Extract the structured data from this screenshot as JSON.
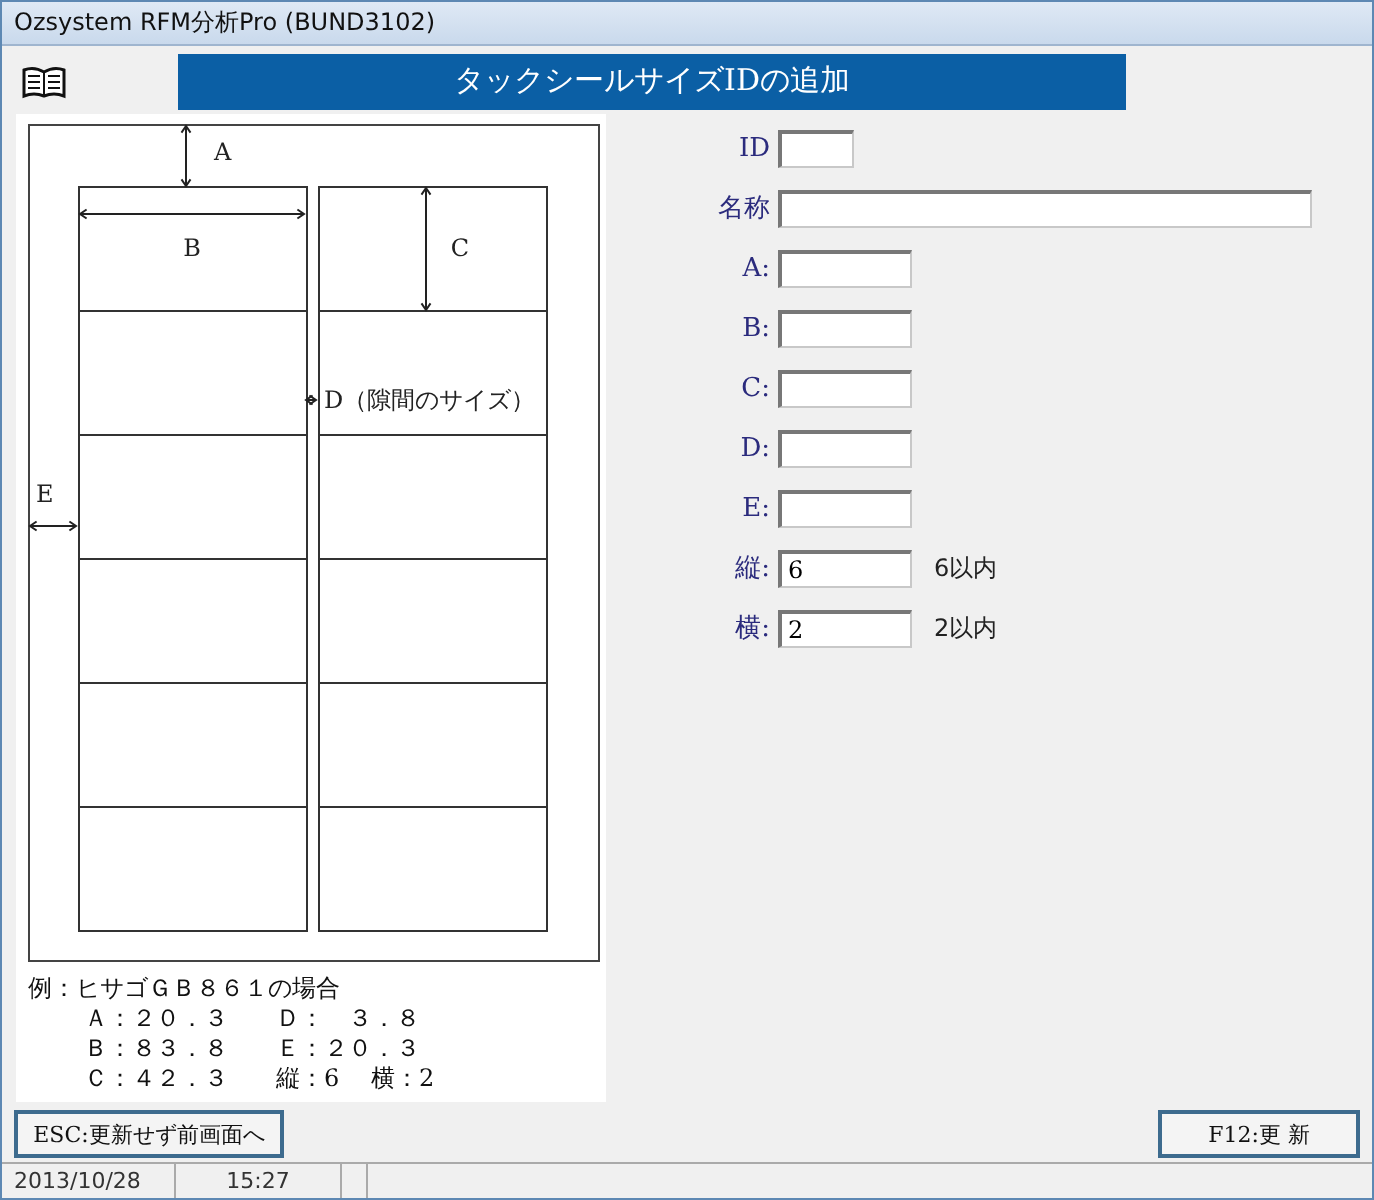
{
  "window": {
    "title": "Ozsystem RFM分析Pro (BUND3102)"
  },
  "header": {
    "title": "タックシールサイズIDの追加"
  },
  "diagram": {
    "labels": [
      {
        "kind": "a",
        "text": "A"
      },
      {
        "kind": "b",
        "text": "B"
      },
      {
        "kind": "c",
        "text": "C"
      },
      {
        "kind": "d",
        "text": "D（隙間のサイズ）"
      },
      {
        "kind": "e",
        "text": "E"
      }
    ]
  },
  "example": {
    "heading": "例：ヒサゴＧＢ８６１の場合",
    "lines": [
      "Ａ：２０．３　　Ｄ：　３．８",
      "Ｂ：８３．８　　Ｅ：２０．３",
      "Ｃ：４２．３　　縦：6　 横：2"
    ]
  },
  "fields": [
    {
      "label": "ID",
      "kind": "tiny"
    },
    {
      "label": "名称",
      "kind": "long"
    },
    {
      "label": "A:",
      "kind": "short"
    },
    {
      "label": "B:",
      "kind": "short"
    },
    {
      "label": "C:",
      "kind": "short"
    },
    {
      "label": "D:",
      "kind": "short"
    },
    {
      "label": "E:",
      "kind": "short"
    },
    {
      "label": "縦:",
      "kind": "short",
      "value": "6",
      "note": "6以内"
    },
    {
      "label": "横:",
      "kind": "short",
      "value": "2",
      "note": "2以内"
    }
  ],
  "buttons": [
    {
      "label": "ESC:更新せず前画面へ",
      "kind": "back"
    },
    {
      "label": "F12:更 新",
      "kind": "update"
    }
  ],
  "status_bar": [
    "2013/10/28",
    "15:27"
  ]
}
